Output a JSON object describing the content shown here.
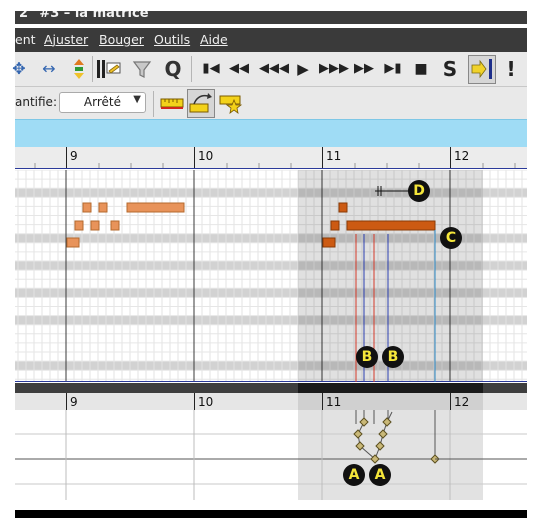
{
  "window": {
    "title": "2\" #3 – la matrice"
  },
  "menu": {
    "items": [
      "ent",
      "Ajuster",
      "Bouger",
      "Outils",
      "Aide"
    ]
  },
  "toolbar": {
    "buttons": [
      "move-four-way",
      "move-horizontal",
      "move-vertical",
      "paste-insert",
      "filter",
      "quantize",
      "goto-start",
      "rewind",
      "fast-rewind",
      "play",
      "fast-forward",
      "forward",
      "goto-end",
      "stop",
      "solo",
      "follow-playhead",
      "panic"
    ],
    "solo_label": "S",
    "quantize_label": "Q",
    "panic_label": "!"
  },
  "quantize": {
    "label": "antifie:",
    "value": "Arrêté"
  },
  "ruler": {
    "measures": [
      "9",
      "10",
      "11",
      "12"
    ]
  },
  "annotations": {
    "a": "A",
    "b": "B",
    "c": "C",
    "d": "D"
  },
  "colors": {
    "note": "#e8935a",
    "selected_note": "#cc5a12",
    "cyan": "#9fdcf5",
    "marker_text": "#f5e63a"
  }
}
